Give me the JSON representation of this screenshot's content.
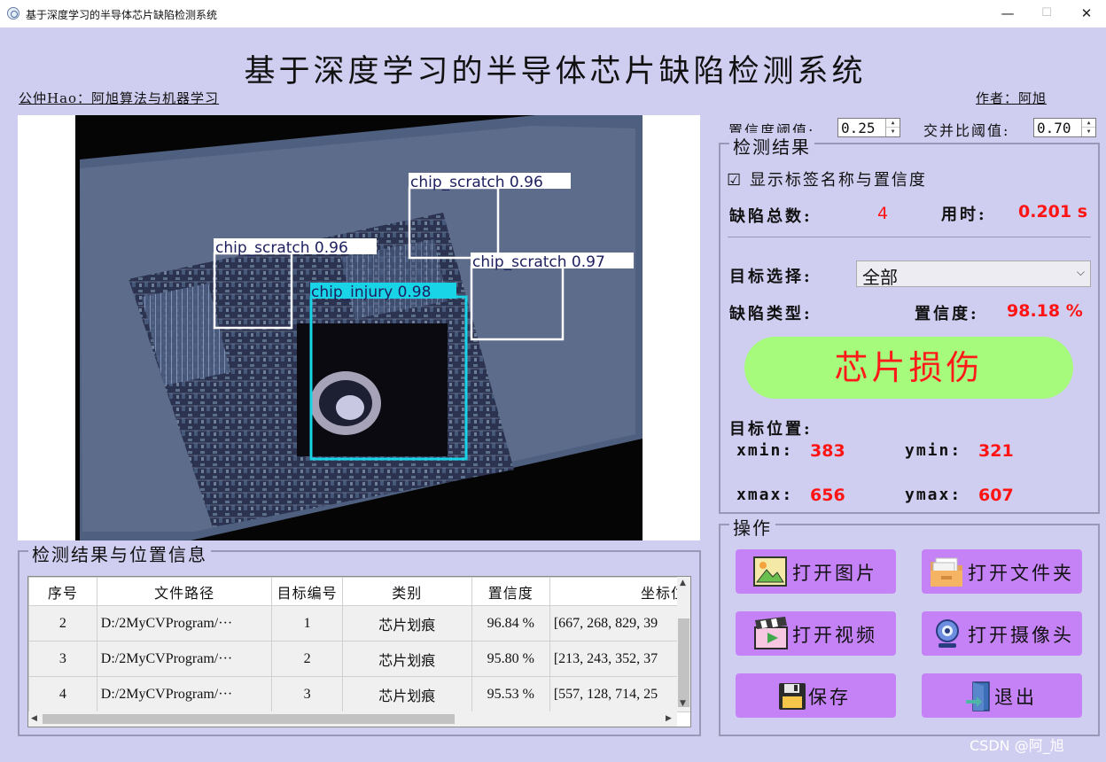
{
  "window": {
    "title": "基于深度学习的半导体芯片缺陷检测系统",
    "minimize": "—",
    "maximize": "☐",
    "close": "✕"
  },
  "header": {
    "main_title": "基于深度学习的半导体芯片缺陷检测系统",
    "left_subtitle": "公仲Hao：阿旭算法与机器学习",
    "right_subtitle": "作者：阿旭"
  },
  "detections": [
    {
      "label": "chip_scratch 0.96",
      "color": "#ffffff"
    },
    {
      "label": "chip_scratch 0.96",
      "color": "#ffffff"
    },
    {
      "label": "chip_scratch 0.97",
      "color": "#ffffff"
    },
    {
      "label": "chip_injury 0.98",
      "color": "#19d3e6"
    }
  ],
  "params": {
    "conf_label": "置信度阈值:",
    "conf_value": "0.25",
    "iou_label": "交并比阈值:",
    "iou_value": "0.70"
  },
  "results": {
    "group_title": "检测结果",
    "show_labels": "显示标签名称与置信度",
    "checkbox_mark": "☑",
    "total_label": "缺陷总数:",
    "total_value": "4",
    "time_label": "用时:",
    "time_value": "0.201 s",
    "target_label": "目标选择:",
    "target_value": "全部",
    "type_label": "缺陷类型:",
    "conf_label": "置信度:",
    "conf_value": "98.18 %",
    "type_value": "芯片损伤",
    "position_label": "目标位置:",
    "xmin_label": "xmin:",
    "xmin": "383",
    "ymin_label": "ymin:",
    "ymin": "321",
    "xmax_label": "xmax:",
    "xmax": "656",
    "ymax_label": "ymax:",
    "ymax": "607"
  },
  "operations": {
    "group_title": "操作",
    "open_image": "打开图片",
    "open_folder": "打开文件夹",
    "open_video": "打开视频",
    "open_camera": "打开摄像头",
    "save": "保存",
    "exit": "退出"
  },
  "table": {
    "group_title": "检测结果与位置信息",
    "columns": [
      "序号",
      "文件路径",
      "目标编号",
      "类别",
      "置信度",
      "坐标位"
    ],
    "rows": [
      [
        "2",
        "D:/2MyCVProgram/···",
        "1",
        "芯片划痕",
        "96.84 %",
        "[667, 268, 829, 39"
      ],
      [
        "3",
        "D:/2MyCVProgram/···",
        "2",
        "芯片划痕",
        "95.80 %",
        "[213, 243, 352, 37"
      ],
      [
        "4",
        "D:/2MyCVProgram/···",
        "3",
        "芯片划痕",
        "95.53 %",
        "[557, 128, 714, 25"
      ]
    ]
  },
  "watermark": "CSDN @阿_旭"
}
